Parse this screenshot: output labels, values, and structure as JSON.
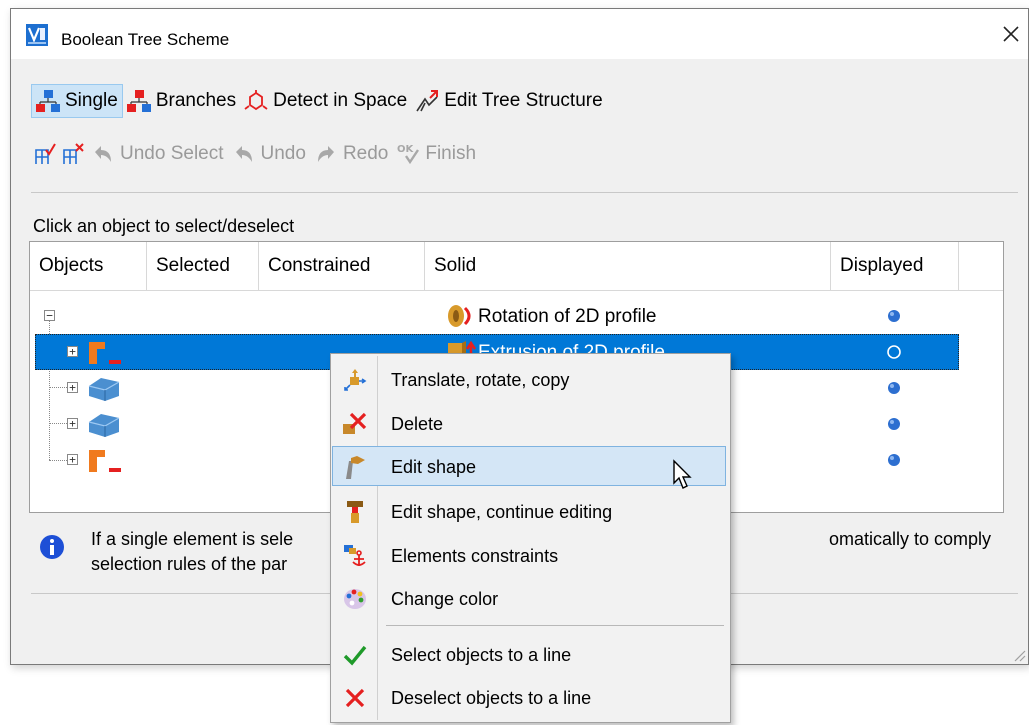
{
  "dialog": {
    "title": "Boolean Tree Scheme",
    "close_icon": "close-icon",
    "logo_icon": "app-logo-icon"
  },
  "toolbar1": {
    "single": "Single",
    "branches": "Branches",
    "detect": "Detect in Space",
    "edit_tree": "Edit Tree Structure",
    "active": "Single"
  },
  "toolbar2": {
    "undo_select": "Undo Select",
    "undo": "Undo",
    "redo": "Redo",
    "finish": "Finish"
  },
  "hint": "Click an object to select/deselect",
  "table": {
    "columns": [
      "Objects",
      "Selected",
      "Constrained",
      "Solid",
      "Displayed"
    ],
    "rows": [
      {
        "solid": "Rotation of 2D profile",
        "displayed": true,
        "selected": false
      },
      {
        "solid": "Extrusion of 2D profile",
        "displayed": true,
        "selected": true
      },
      {
        "solid": "",
        "displayed": true,
        "selected": false
      },
      {
        "solid": "",
        "displayed": true,
        "selected": false
      },
      {
        "solid": "",
        "displayed": true,
        "selected": false
      }
    ]
  },
  "info": {
    "line1_start": "If a single element is sele",
    "line1_end": "omatically to comply",
    "line2_start": "selection rules of the par"
  },
  "context_menu": {
    "items": [
      {
        "label": "Translate, rotate, copy",
        "icon": "translate-icon"
      },
      {
        "label": "Delete",
        "icon": "delete-icon"
      },
      {
        "label": "Edit shape",
        "icon": "edit-shape-icon",
        "highlighted": true
      },
      {
        "label": "Edit shape, continue editing",
        "icon": "edit-shape-continue-icon"
      },
      {
        "label": "Elements constraints",
        "icon": "anchor-icon"
      },
      {
        "label": "Change color",
        "icon": "palette-icon"
      },
      {
        "label": "Select objects to a line",
        "icon": "checkmark-icon"
      },
      {
        "label": "Deselect objects to a line",
        "icon": "cross-icon"
      }
    ]
  },
  "colors": {
    "selection": "#0078d7",
    "menu_highlight": "#d4e6f6",
    "dialog_bg": "#f0f0f0"
  }
}
